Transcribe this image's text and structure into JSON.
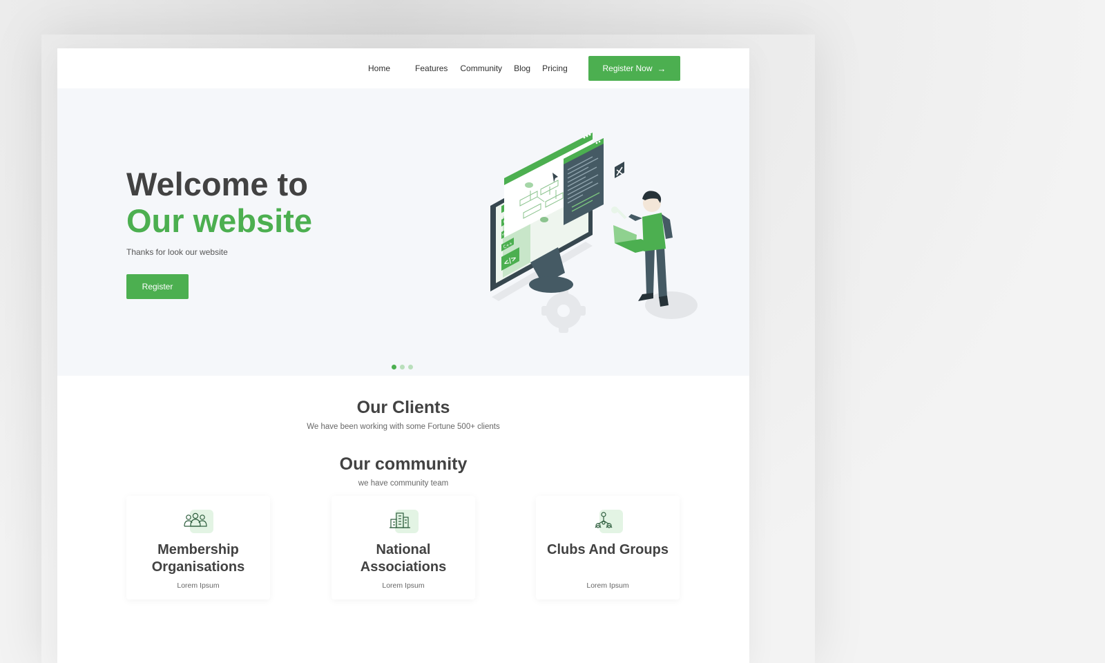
{
  "nav": {
    "items": [
      "Home",
      "Features",
      "Community",
      "Blog",
      "Pricing"
    ],
    "cta_label": "Register Now",
    "cta_icon": "arrow-right-icon"
  },
  "hero": {
    "title_line1": "Welcome to",
    "title_line2": "Our website",
    "subtitle": "Thanks for look our website",
    "button_label": "Register",
    "carousel": {
      "slides": 3,
      "active": 1
    },
    "illustration_labels": [
      "CSS",
      "HTML",
      "C++",
      "</>"
    ]
  },
  "clients": {
    "title": "Our Clients",
    "subtitle": "We have been working with some Fortune 500+ clients"
  },
  "community": {
    "title": "Our community",
    "subtitle": "we have community team",
    "cards": [
      {
        "title": "Membership Organisations",
        "desc": "Lorem Ipsum",
        "icon": "people-group-icon"
      },
      {
        "title": "National Associations",
        "desc": "Lorem Ipsum",
        "icon": "building-icon"
      },
      {
        "title": "Clubs And Groups",
        "desc": "Lorem Ipsum",
        "icon": "network-icon"
      }
    ]
  },
  "colors": {
    "accent": "#4caf50",
    "text_dark": "#424242",
    "hero_bg": "#f5f7fa",
    "icon_bg": "#e3f4e4"
  }
}
